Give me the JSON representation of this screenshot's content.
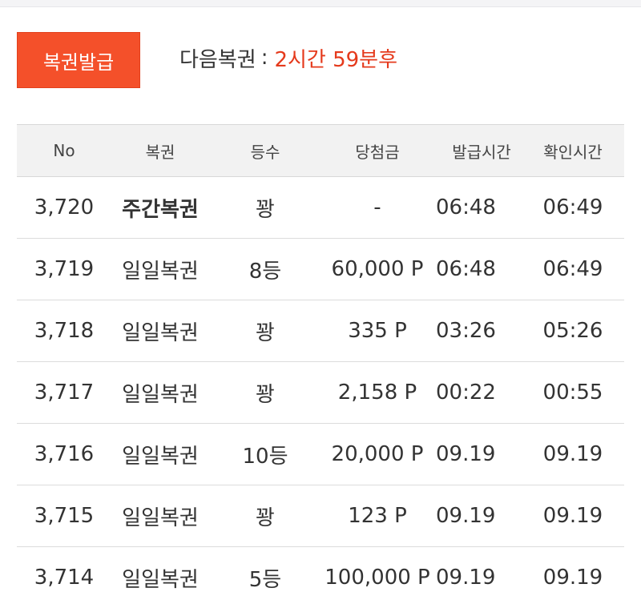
{
  "header": {
    "issue_button_label": "복권발급",
    "next_label": "다음복권",
    "next_colon": ":",
    "next_value": "2시간 59분후"
  },
  "table": {
    "columns": [
      "No",
      "복권",
      "등수",
      "당첨금",
      "발급시간",
      "확인시간"
    ],
    "rows": [
      {
        "no": "3,720",
        "name": "주간복권",
        "rank": "꽝",
        "prize": "-",
        "issued": "06:48",
        "checked": "06:49",
        "bold": true
      },
      {
        "no": "3,719",
        "name": "일일복권",
        "rank": "8등",
        "prize": "60,000 P",
        "issued": "06:48",
        "checked": "06:49"
      },
      {
        "no": "3,718",
        "name": "일일복권",
        "rank": "꽝",
        "prize": "335 P",
        "issued": "03:26",
        "checked": "05:26"
      },
      {
        "no": "3,717",
        "name": "일일복권",
        "rank": "꽝",
        "prize": "2,158 P",
        "issued": "00:22",
        "checked": "00:55"
      },
      {
        "no": "3,716",
        "name": "일일복권",
        "rank": "10등",
        "prize": "20,000 P",
        "issued": "09.19",
        "checked": "09.19"
      },
      {
        "no": "3,715",
        "name": "일일복권",
        "rank": "꽝",
        "prize": "123 P",
        "issued": "09.19",
        "checked": "09.19"
      },
      {
        "no": "3,714",
        "name": "일일복권",
        "rank": "5등",
        "prize": "100,000 P",
        "issued": "09.19",
        "checked": "09.19"
      }
    ]
  },
  "colors": {
    "accent": "#f4502a",
    "highlight_text": "#e53a1c",
    "header_bg": "#f2f2f2"
  }
}
